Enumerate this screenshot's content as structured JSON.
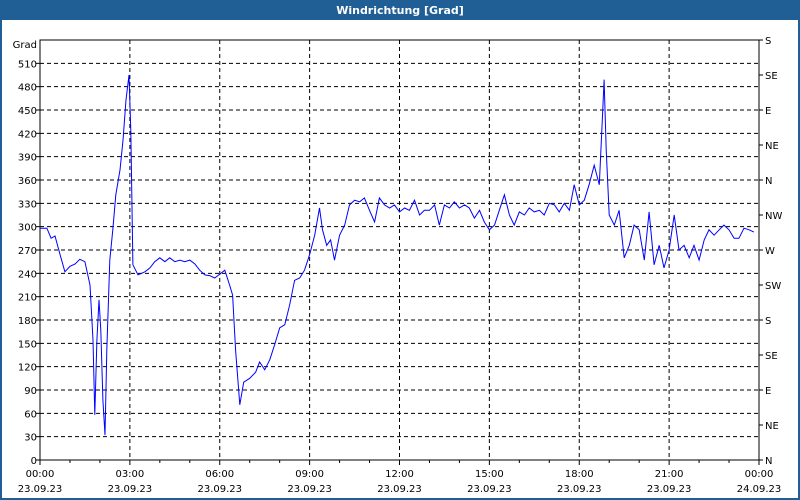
{
  "window": {
    "title": "Windrichtung [Grad]"
  },
  "colors": {
    "titlebar": "#1f5f96",
    "line": "#0000ff",
    "grid": "#000000"
  },
  "chart_data": {
    "type": "line",
    "title": "Windrichtung [Grad]",
    "ylabel": "Grad",
    "ylim": [
      0,
      540
    ],
    "xlim_hours": [
      0,
      24
    ],
    "yticks": [
      0,
      30,
      60,
      90,
      120,
      150,
      180,
      210,
      240,
      270,
      300,
      330,
      360,
      390,
      420,
      450,
      480,
      510
    ],
    "right_ticks": [
      {
        "value": 0,
        "label": "N"
      },
      {
        "value": 30,
        "label": "NE"
      },
      {
        "value": 60,
        "label": "E"
      },
      {
        "value": 90,
        "label": "SE"
      },
      {
        "value": 120,
        "label": "S"
      },
      {
        "value": 150,
        "label": "SW"
      },
      {
        "value": 180,
        "label": "W"
      },
      {
        "value": 210,
        "label": "NW"
      },
      {
        "value": 240,
        "label": "N"
      },
      {
        "value": 270,
        "label": "NE"
      },
      {
        "value": 300,
        "label": "E"
      },
      {
        "value": 330,
        "label": "SE"
      },
      {
        "value": 360,
        "label": "S"
      }
    ],
    "xticks": [
      {
        "hour": 0,
        "time": "00:00",
        "date": "23.09.23"
      },
      {
        "hour": 3,
        "time": "03:00",
        "date": "23.09.23"
      },
      {
        "hour": 6,
        "time": "06:00",
        "date": "23.09.23"
      },
      {
        "hour": 9,
        "time": "09:00",
        "date": "23.09.23"
      },
      {
        "hour": 12,
        "time": "12:00",
        "date": "23.09.23"
      },
      {
        "hour": 15,
        "time": "15:00",
        "date": "23.09.23"
      },
      {
        "hour": 18,
        "time": "18:00",
        "date": "23.09.23"
      },
      {
        "hour": 21,
        "time": "21:00",
        "date": "23.09.23"
      },
      {
        "hour": 24,
        "time": "00:00",
        "date": "24.09.23"
      }
    ],
    "grid": true,
    "series": [
      {
        "name": "Windrichtung",
        "points": [
          [
            0,
            298
          ],
          [
            0.23,
            298
          ],
          [
            0.37,
            285
          ],
          [
            0.5,
            288
          ],
          [
            0.67,
            264
          ],
          [
            0.83,
            242
          ],
          [
            1,
            249
          ],
          [
            1.17,
            252
          ],
          [
            1.33,
            258
          ],
          [
            1.5,
            255
          ],
          [
            1.67,
            225
          ],
          [
            1.77,
            154
          ],
          [
            1.83,
            58
          ],
          [
            1.9,
            154
          ],
          [
            1.97,
            206
          ],
          [
            2.03,
            167
          ],
          [
            2.1,
            77
          ],
          [
            2.17,
            32
          ],
          [
            2.23,
            141
          ],
          [
            2.33,
            257
          ],
          [
            2.43,
            296
          ],
          [
            2.53,
            341
          ],
          [
            2.67,
            373
          ],
          [
            2.77,
            411
          ],
          [
            2.87,
            463
          ],
          [
            2.97,
            495
          ],
          [
            3.03,
            424
          ],
          [
            3.1,
            251
          ],
          [
            3.27,
            238
          ],
          [
            3.5,
            242
          ],
          [
            3.67,
            247
          ],
          [
            3.83,
            255
          ],
          [
            4,
            260
          ],
          [
            4.17,
            255
          ],
          [
            4.33,
            260
          ],
          [
            4.5,
            255
          ],
          [
            4.67,
            257
          ],
          [
            4.83,
            255
          ],
          [
            5,
            257
          ],
          [
            5.17,
            252
          ],
          [
            5.33,
            244
          ],
          [
            5.5,
            238
          ],
          [
            5.67,
            237
          ],
          [
            5.83,
            234
          ],
          [
            6,
            239
          ],
          [
            6.17,
            244
          ],
          [
            6.33,
            225
          ],
          [
            6.43,
            212
          ],
          [
            6.53,
            141
          ],
          [
            6.67,
            71
          ],
          [
            6.8,
            100
          ],
          [
            7,
            105
          ],
          [
            7.2,
            113
          ],
          [
            7.33,
            126
          ],
          [
            7.5,
            116
          ],
          [
            7.67,
            129
          ],
          [
            7.83,
            148
          ],
          [
            8,
            170
          ],
          [
            8.17,
            174
          ],
          [
            8.33,
            199
          ],
          [
            8.5,
            231
          ],
          [
            8.67,
            234
          ],
          [
            8.83,
            244
          ],
          [
            9,
            264
          ],
          [
            9.17,
            289
          ],
          [
            9.33,
            324
          ],
          [
            9.43,
            296
          ],
          [
            9.57,
            276
          ],
          [
            9.7,
            283
          ],
          [
            9.83,
            257
          ],
          [
            10,
            289
          ],
          [
            10.17,
            302
          ],
          [
            10.33,
            328
          ],
          [
            10.5,
            334
          ],
          [
            10.67,
            332
          ],
          [
            10.83,
            337
          ],
          [
            11,
            321
          ],
          [
            11.17,
            306
          ],
          [
            11.33,
            337
          ],
          [
            11.5,
            328
          ],
          [
            11.67,
            324
          ],
          [
            11.83,
            328
          ],
          [
            12,
            319
          ],
          [
            12.17,
            324
          ],
          [
            12.33,
            321
          ],
          [
            12.5,
            334
          ],
          [
            12.67,
            315
          ],
          [
            12.83,
            321
          ],
          [
            13,
            321
          ],
          [
            13.17,
            328
          ],
          [
            13.33,
            302
          ],
          [
            13.5,
            328
          ],
          [
            13.67,
            324
          ],
          [
            13.83,
            332
          ],
          [
            14,
            324
          ],
          [
            14.17,
            328
          ],
          [
            14.33,
            324
          ],
          [
            14.5,
            311
          ],
          [
            14.67,
            321
          ],
          [
            14.83,
            306
          ],
          [
            15,
            296
          ],
          [
            15.17,
            302
          ],
          [
            15.33,
            321
          ],
          [
            15.5,
            341
          ],
          [
            15.67,
            315
          ],
          [
            15.83,
            302
          ],
          [
            16,
            319
          ],
          [
            16.17,
            315
          ],
          [
            16.33,
            324
          ],
          [
            16.5,
            319
          ],
          [
            16.67,
            321
          ],
          [
            16.83,
            315
          ],
          [
            17,
            330
          ],
          [
            17.17,
            328
          ],
          [
            17.33,
            319
          ],
          [
            17.5,
            330
          ],
          [
            17.67,
            321
          ],
          [
            17.83,
            354
          ],
          [
            18,
            328
          ],
          [
            18.17,
            334
          ],
          [
            18.33,
            354
          ],
          [
            18.5,
            379
          ],
          [
            18.67,
            354
          ],
          [
            18.77,
            437
          ],
          [
            18.83,
            489
          ],
          [
            18.9,
            399
          ],
          [
            19,
            315
          ],
          [
            19.17,
            302
          ],
          [
            19.33,
            321
          ],
          [
            19.5,
            260
          ],
          [
            19.67,
            276
          ],
          [
            19.83,
            302
          ],
          [
            20,
            296
          ],
          [
            20.17,
            257
          ],
          [
            20.33,
            319
          ],
          [
            20.5,
            251
          ],
          [
            20.67,
            276
          ],
          [
            20.83,
            247
          ],
          [
            21,
            270
          ],
          [
            21.17,
            315
          ],
          [
            21.33,
            270
          ],
          [
            21.5,
            276
          ],
          [
            21.67,
            260
          ],
          [
            21.83,
            276
          ],
          [
            22,
            257
          ],
          [
            22.17,
            283
          ],
          [
            22.33,
            296
          ],
          [
            22.5,
            289
          ],
          [
            22.67,
            296
          ],
          [
            22.83,
            302
          ],
          [
            23,
            296
          ],
          [
            23.17,
            285
          ],
          [
            23.33,
            285
          ],
          [
            23.5,
            298
          ],
          [
            23.67,
            296
          ],
          [
            23.83,
            293
          ]
        ]
      }
    ]
  }
}
